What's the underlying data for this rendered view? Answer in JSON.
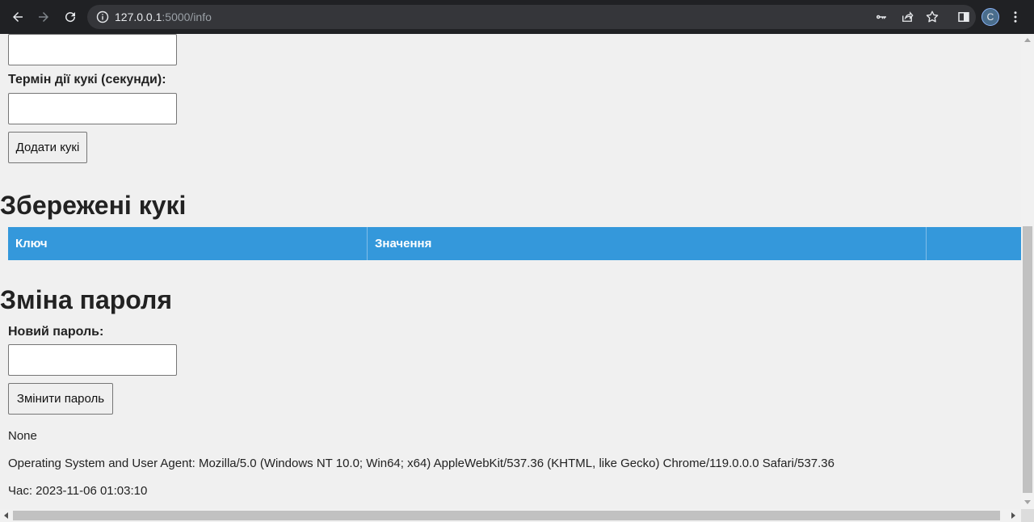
{
  "browser": {
    "url_host": "127.0.0.1",
    "url_path": ":5000/info",
    "avatar_letter": "C"
  },
  "cookie_form": {
    "expiry_label": "Термін дії кукі (секунди):",
    "add_button": "Додати кукі"
  },
  "saved_cookies": {
    "heading": "Збережені кукі",
    "columns": [
      "Ключ",
      "Значення",
      ""
    ]
  },
  "password_form": {
    "heading": "Зміна пароля",
    "new_password_label": "Новий пароль:",
    "change_button": "Змінити пароль"
  },
  "footer": {
    "status": "None",
    "user_agent": "Operating System and User Agent: Mozilla/5.0 (Windows NT 10.0; Win64; x64) AppleWebKit/537.36 (KHTML, like Gecko) Chrome/119.0.0.0 Safari/537.36",
    "time": "Час: 2023-11-06 01:03:10"
  },
  "colors": {
    "table_header": "#3498db",
    "page_background": "#f0f0f0",
    "chrome_background": "#202124"
  }
}
